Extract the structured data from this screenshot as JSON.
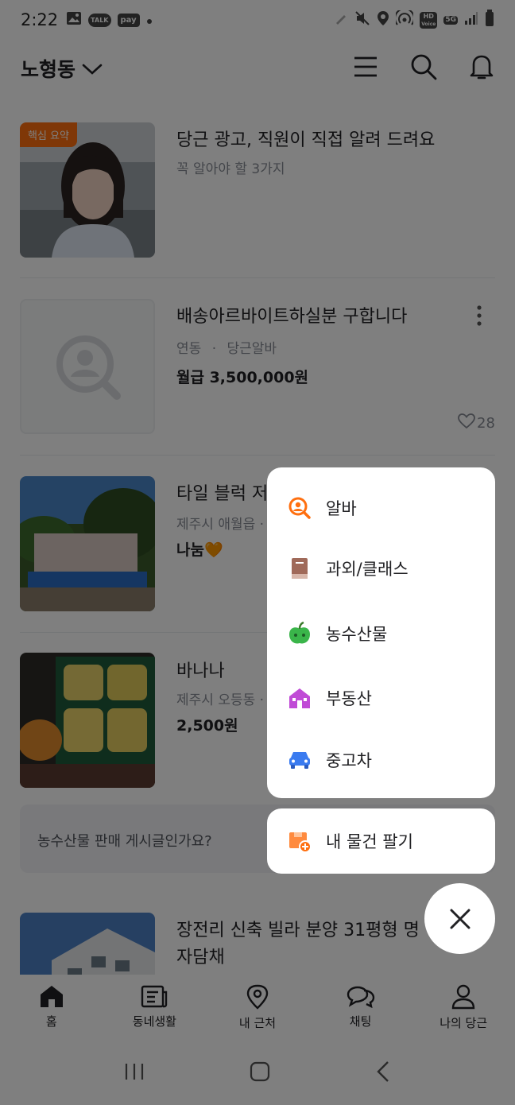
{
  "status_bar": {
    "time": "2:22",
    "talk_label": "TALK",
    "pay_label": "pay",
    "hd_label": "HD",
    "voice_label": "Voice",
    "network_label": "5G"
  },
  "header": {
    "location": "노형동"
  },
  "feed": {
    "ad": {
      "badge": "핵심 요약",
      "title": "당근 광고, 직원이 직접 알려 드려요",
      "subtitle": "꼭 알아야 할 3가지"
    },
    "job": {
      "title": "배송아르바이트하실분 구합니다",
      "location": "연동",
      "separator": "·",
      "source": "당근알바",
      "price": "월급 3,500,000원",
      "likes": "28"
    },
    "tile": {
      "title": "타일 블럭 저",
      "location": "제주시 애월읍 ·",
      "price": "나눔🧡"
    },
    "banana": {
      "title": "바나나",
      "location": "제주시 오등동 ·",
      "price": "2,500원"
    },
    "notice": "농수산물 판매 게시글인가요?",
    "villa": {
      "title_line1": "장전리 신축 빌라 분양 31평형 명",
      "title_line2": "자담채"
    }
  },
  "menu": {
    "items": [
      {
        "label": "알바",
        "icon": "job-icon",
        "color": "#ff6f0f"
      },
      {
        "label": "과외/클래스",
        "icon": "book-icon",
        "color": "#a06a5a"
      },
      {
        "label": "농수산물",
        "icon": "apple-icon",
        "color": "#3ab54a"
      },
      {
        "label": "부동산",
        "icon": "house-icon",
        "color": "#c04bd6"
      },
      {
        "label": "중고차",
        "icon": "car-icon",
        "color": "#3a7bf0"
      }
    ],
    "sell_label": "내 물건 팔기"
  },
  "tabs": [
    {
      "label": "홈",
      "icon": "home-icon"
    },
    {
      "label": "동네생활",
      "icon": "newspaper-icon"
    },
    {
      "label": "내 근처",
      "icon": "location-pin-icon"
    },
    {
      "label": "채팅",
      "icon": "chat-icon"
    },
    {
      "label": "나의 당근",
      "icon": "person-icon"
    }
  ],
  "colors": {
    "accent": "#ff6f0f",
    "dim_overlay": "rgba(0,0,0,0.5)"
  }
}
